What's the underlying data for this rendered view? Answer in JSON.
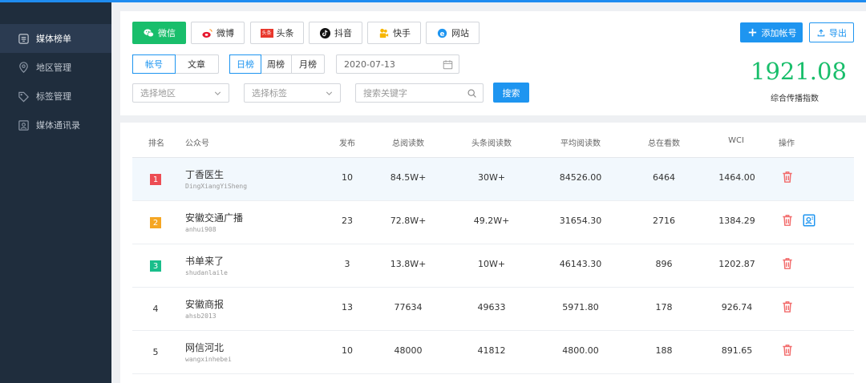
{
  "sidebar": {
    "items": [
      {
        "label": "媒体榜单",
        "icon": "ranking-list-icon",
        "active": true
      },
      {
        "label": "地区管理",
        "icon": "location-pin-icon",
        "active": false
      },
      {
        "label": "标签管理",
        "icon": "tag-icon",
        "active": false
      },
      {
        "label": "媒体通讯录",
        "icon": "contact-card-icon",
        "active": false
      }
    ]
  },
  "platforms": [
    {
      "label": "微信",
      "icon": "wechat-icon",
      "active": true
    },
    {
      "label": "微博",
      "icon": "weibo-icon",
      "active": false
    },
    {
      "label": "头条",
      "icon": "toutiao-icon",
      "active": false
    },
    {
      "label": "抖音",
      "icon": "douyin-icon",
      "active": false
    },
    {
      "label": "快手",
      "icon": "kuaishou-icon",
      "active": false
    },
    {
      "label": "网站",
      "icon": "website-icon",
      "active": false
    }
  ],
  "toutiao_logo_text": "头条",
  "actions": {
    "add_account": "添加帐号",
    "export": "导出"
  },
  "type_tabs": [
    {
      "label": "帐号",
      "selected": true
    },
    {
      "label": "文章",
      "selected": false
    }
  ],
  "period_tabs": [
    {
      "label": "日榜",
      "selected": true
    },
    {
      "label": "周榜",
      "selected": false
    },
    {
      "label": "月榜",
      "selected": false
    }
  ],
  "date": "2020-07-13",
  "filters": {
    "region_placeholder": "选择地区",
    "tag_placeholder": "选择标签",
    "keyword_placeholder": "搜索关键字",
    "search_button": "搜索"
  },
  "index": {
    "value": "1921.08",
    "label": "综合传播指数"
  },
  "table": {
    "columns": [
      "排名",
      "公众号",
      "发布",
      "总阅读数",
      "头条阅读数",
      "平均阅读数",
      "总在看数",
      "WCI",
      "操作"
    ],
    "rows": [
      {
        "rank": "1",
        "name": "丁香医生",
        "id": "DingXiangYiSheng",
        "publish": "10",
        "total_reads": "84.5W+",
        "top_reads": "30W+",
        "avg_reads": "84526.00",
        "likes": "6464",
        "wci": "1464.00",
        "badge_color": "#ed4d54",
        "has_profile": false
      },
      {
        "rank": "2",
        "name": "安徽交通广播",
        "id": "anhui908",
        "publish": "23",
        "total_reads": "72.8W+",
        "top_reads": "49.2W+",
        "avg_reads": "31654.30",
        "likes": "2716",
        "wci": "1384.29",
        "badge_color": "#f5a623",
        "has_profile": true
      },
      {
        "rank": "3",
        "name": "书单来了",
        "id": "shudanlaile",
        "publish": "3",
        "total_reads": "13.8W+",
        "top_reads": "10W+",
        "avg_reads": "46143.30",
        "likes": "896",
        "wci": "1202.87",
        "badge_color": "#19be8b",
        "has_profile": false
      },
      {
        "rank": "4",
        "name": "安徽商报",
        "id": "ahsb2013",
        "publish": "13",
        "total_reads": "77634",
        "top_reads": "49633",
        "avg_reads": "5971.80",
        "likes": "178",
        "wci": "926.74",
        "badge_color": "",
        "has_profile": false
      },
      {
        "rank": "5",
        "name": "网信河北",
        "id": "wangxinhebei",
        "publish": "10",
        "total_reads": "48000",
        "top_reads": "41812",
        "avg_reads": "4800.00",
        "likes": "188",
        "wci": "891.65",
        "badge_color": "",
        "has_profile": false
      }
    ]
  },
  "colors": {
    "accent": "#1e95f0",
    "wechat_green": "#19be6b",
    "sidebar_bg": "#1f2d3d",
    "delete_red": "#f26b6b"
  }
}
